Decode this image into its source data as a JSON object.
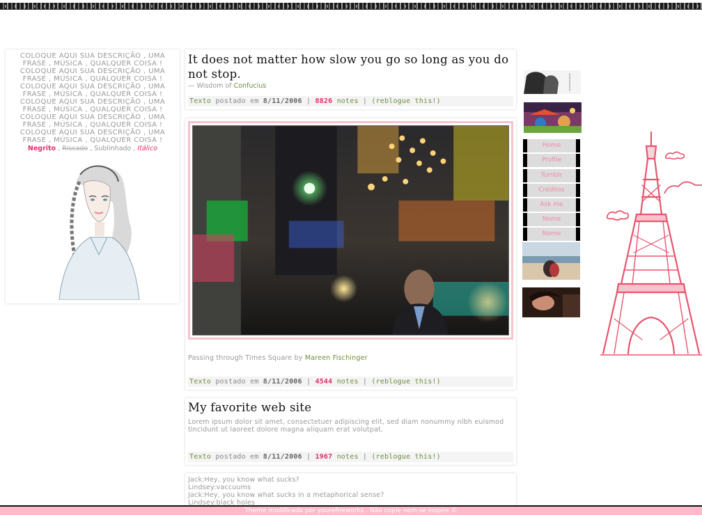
{
  "sidebar": {
    "description_lines": [
      "COLOQUE AQUI SUA DESCRIÇÃO , UMA",
      "FRASE , MÚSICA , QUALQUER COISA !",
      "COLOQUE AQUI SUA DESCRIÇÃO , UMA",
      "FRASE , MÚSICA , QUALQUER COISA !",
      "COLOQUE AQUI SUA DESCRIÇÃO , UMA",
      "FRASE , MÚSICA , QUALQUER COISA !",
      "COLOQUE AQUI SUA DESCRIÇÃO , UMA",
      "FRASE , MÚSICA , QUALQUER COISA !",
      "COLOQUE AQUI SUA DESCRIÇÃO , UMA",
      "FRASE , MÚSICA , QUALQUER COISA !",
      "COLOQUE AQUI SUA DESCRIÇÃO , UMA",
      "FRASE , MÚSICA , QUALQUER COISA !"
    ],
    "style_bold": "Negrito",
    "style_strike": "Riscado",
    "style_underline": "Sublinhado",
    "style_italic": "Itálico",
    "separator": " , "
  },
  "posts": {
    "quote": {
      "text": "It does not matter how slow you go so long as you do not stop.",
      "source_prefix": "— Wisdom of ",
      "source_link": "Confucius",
      "meta": {
        "type": "Texto",
        "posted": " postado em ",
        "date": "8/11/2006",
        "count": "8826",
        "notes": "notes",
        "reblog": "(reblogue this!)"
      }
    },
    "photo": {
      "caption_prefix": "Passing through Times Square by ",
      "caption_link": "Mareen Fischinger",
      "meta": {
        "type": "Texto",
        "posted": " postado em ",
        "date": "8/11/2006",
        "count": "4544",
        "notes": "notes",
        "reblog": "(reblogue this!)"
      }
    },
    "text": {
      "title": "My favorite web site",
      "body": "Lorem ipsum dolor sit amet, consectetuer adipiscing elit, sed diam nonummy nibh euismod tincidunt ut laoreet dolore magna aliquam erat volutpat.",
      "meta": {
        "type": "Texto",
        "posted": " postado em ",
        "date": "8/11/2006",
        "count": "1967",
        "notes": "notes",
        "reblog": "(reblogue this!)"
      }
    },
    "chat": {
      "lines": [
        "Jack:Hey, you know what sucks?",
        "Lindsey:vaccuums",
        "Jack:Hey, you know what sucks in a metaphorical sense?",
        "Lindsey:black holes"
      ]
    }
  },
  "nav": {
    "items": [
      "Home",
      "Profile",
      "Tumblr",
      "Créditos",
      "Ask me",
      "Nome",
      "Nome"
    ]
  },
  "footer": {
    "text": "Theme modificado por yourefireworks . Não copie nem se inspire ©"
  },
  "colors": {
    "accent_pink": "#e0306a",
    "nav_text": "#f389a6",
    "link_green": "#6c8c3c",
    "footer_bg": "#ffb9c8",
    "eiffel": "#e8546e"
  }
}
